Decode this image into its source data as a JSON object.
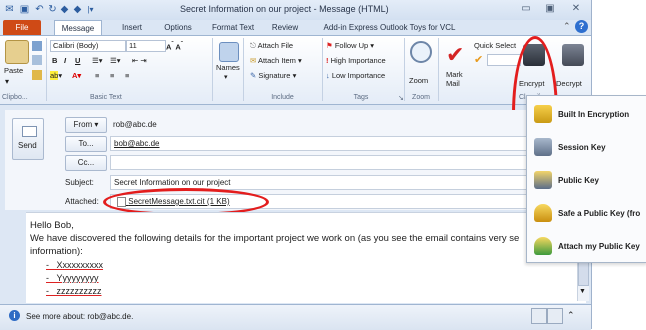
{
  "window": {
    "title": "Secret Information on our project - Message (HTML)"
  },
  "tabs": [
    "File",
    "Message",
    "Insert",
    "Options",
    "Format Text",
    "Review",
    "Add-in Express Outlook Toys for VCL"
  ],
  "ribbon": {
    "clipboard": {
      "paste_label": "Paste",
      "group_label": "Clipbo..."
    },
    "basic_text": {
      "font_name": "Calibri (Body)",
      "font_size": "11",
      "group_label": "Basic Text"
    },
    "names": {
      "label": "Names"
    },
    "include": {
      "attach_file": "Attach File",
      "attach_item": "Attach Item",
      "signature": "Signature",
      "group_label": "Include"
    },
    "tags": {
      "follow_up": "Follow Up",
      "high_importance": "High Importance",
      "low_importance": "Low Importance",
      "group_label": "Tags"
    },
    "zoom": {
      "label": "Zoom",
      "group_label": "Zoom"
    },
    "mark_mail": {
      "label1": "Mark",
      "label2": "Mail"
    },
    "quick_select": {
      "label": "Quick Select"
    },
    "classify": {
      "group_label": "Classif"
    },
    "encrypt": {
      "label": "Encrypt"
    },
    "decrypt": {
      "label": "Decrypt"
    }
  },
  "compose": {
    "send_label": "Send",
    "from_label": "From",
    "from_value": "rob@abc.de",
    "to_label": "To...",
    "to_value": "bob@abc.de",
    "cc_label": "Cc...",
    "cc_value": "",
    "subject_label": "Subject:",
    "subject_value": "Secret Information on our project",
    "attached_label": "Attached:",
    "attachment": "SecretMessage.txt.cit (1 KB)"
  },
  "body": {
    "greeting": "Hello Bob,",
    "line1": "We have discovered the following details for the important project we work on (as you see the email contains very se",
    "line2": "information):",
    "items": [
      "Xxxxxxxxxx",
      "Yyyyyyyyy",
      "zzzzzzzzzz"
    ]
  },
  "people_pane": {
    "text": "See more about: rob@abc.de."
  },
  "encrypt_menu": {
    "items": [
      {
        "label": "Built In Encryption",
        "icon": "shield-lock-icon"
      },
      {
        "label": "Session Key",
        "icon": "session-key-icon"
      },
      {
        "label": "Public Key",
        "icon": "public-key-icon"
      },
      {
        "label": "Safe a Public Key (fro",
        "icon": "save-key-icon"
      },
      {
        "label": "Attach my Public Key",
        "icon": "attach-key-icon"
      }
    ]
  },
  "colors": {
    "file_tab": "#cf4a16",
    "highlight_ellipse": "#e31d1d",
    "accent": "#2d5d9f"
  }
}
